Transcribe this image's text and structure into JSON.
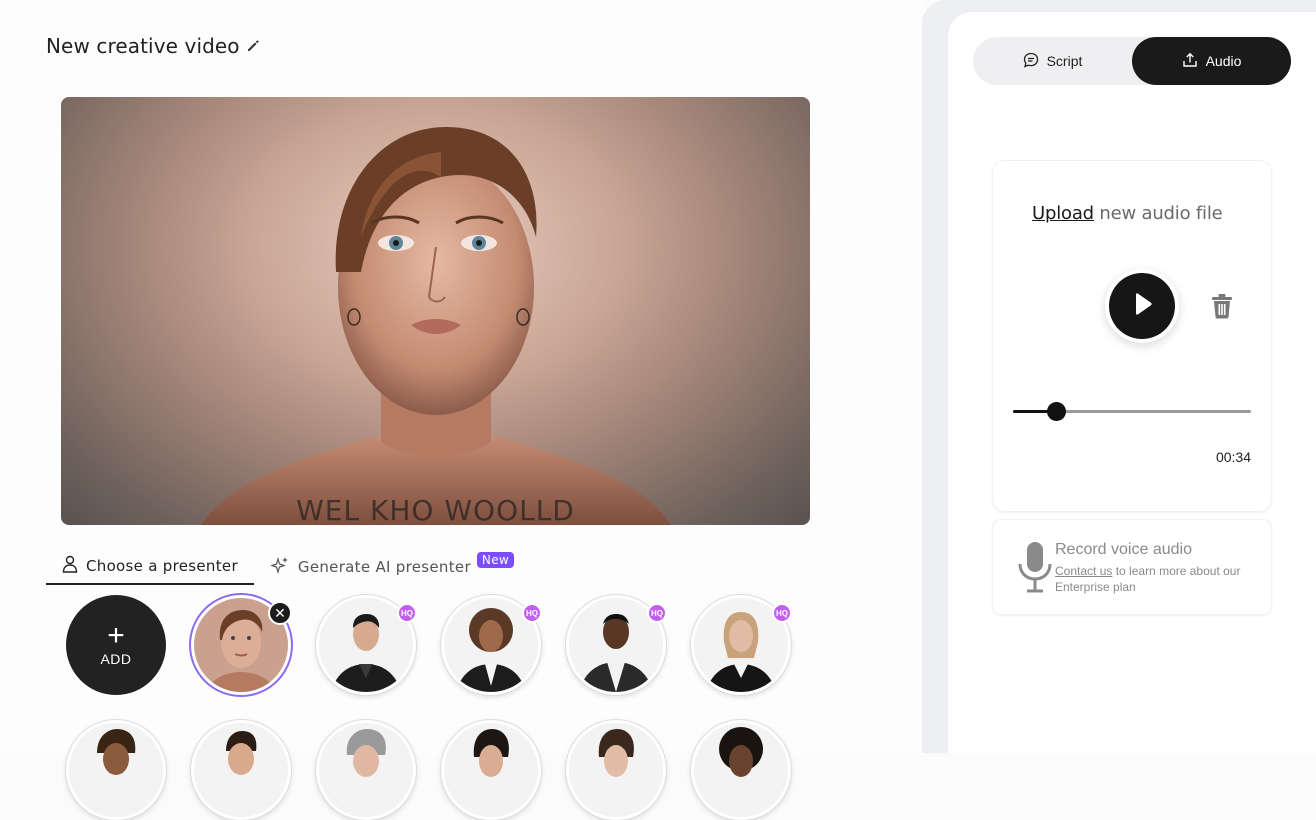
{
  "project": {
    "title": "New creative video"
  },
  "preview": {
    "overlay_text": "WEL KHO WOOLLD"
  },
  "tabs": [
    {
      "label": "Choose a presenter",
      "active": true
    },
    {
      "label": "Generate AI presenter",
      "badge": "New",
      "active": false
    }
  ],
  "presenters": {
    "add_label": "ADD",
    "plus_symbol": "+",
    "hq_label": "HQ",
    "close_symbol": "✕",
    "items": [
      {
        "name": "selected-woman",
        "selected": true,
        "hq": false
      },
      {
        "name": "man-dark-suit",
        "selected": false,
        "hq": true
      },
      {
        "name": "woman-curly-hair",
        "selected": false,
        "hq": true
      },
      {
        "name": "man-white-shirt",
        "selected": false,
        "hq": true
      },
      {
        "name": "woman-blonde",
        "selected": false,
        "hq": true
      }
    ]
  },
  "right_panel": {
    "segments": [
      {
        "label": "Script",
        "icon": "chat-icon",
        "active": false
      },
      {
        "label": "Audio",
        "icon": "upload-icon",
        "active": true
      }
    ],
    "audio": {
      "upload_link": "Upload",
      "upload_rest": " new audio file",
      "time": "00:34",
      "progress_fraction": 0.18
    },
    "record": {
      "title": "Record voice audio",
      "contact_link": "Contact us",
      "contact_rest": " to learn more about our Enterprise plan"
    }
  },
  "colors": {
    "accent": "#7c4dff",
    "hq_badge": "#c25ff0",
    "dark": "#1a1a1a"
  }
}
